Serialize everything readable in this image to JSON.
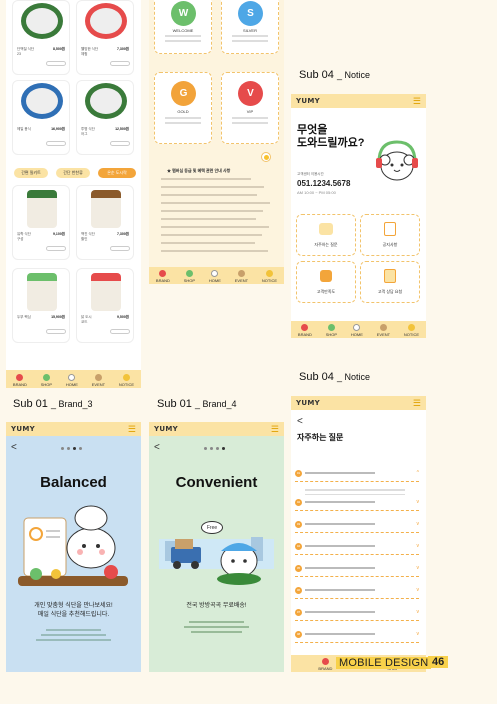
{
  "labels": {
    "sub04_notice_a": "Sub 04",
    "sub04_notice_a_suffix": "_ Notice",
    "sub04_notice_b": "Sub 04",
    "sub04_notice_b_suffix": "_ Notice",
    "sub01_brand3": "Sub 01",
    "sub01_brand3_suffix": "_ Brand_3",
    "sub01_brand4": "Sub 01",
    "sub01_brand4_suffix": "_ Brand_4"
  },
  "brand": {
    "logo": "YUMY"
  },
  "tabbar": [
    "BRAND",
    "SHOP",
    "HOME",
    "EVENT",
    "NOTICE"
  ],
  "shop": {
    "products": [
      {
        "name": "단백질 식단\n23",
        "price": "8,500원"
      },
      {
        "name": "웰빙한 식단\n체험",
        "price": "7,300원"
      },
      {
        "name": "헤일 용식",
        "price": "16,900원"
      },
      {
        "name": "투명 식단\n어그",
        "price": "12,500원"
      },
      {
        "name": "유학 식단\n구성",
        "price": "9,100원"
      },
      {
        "name": "백진 식단\n할인",
        "price": "7,300원"
      },
      {
        "name": "두부 핵심",
        "price": "15,900원"
      },
      {
        "name": "닭 도시\n코드",
        "price": "9,500원"
      }
    ],
    "filters": [
      "간편 밀키트",
      "간단 반찬류",
      "온순 도시락"
    ],
    "btn": "장바구니"
  },
  "membership": {
    "tiers": [
      {
        "letter": "W",
        "name": "WELCOME",
        "color": "#6cbf6b"
      },
      {
        "letter": "S",
        "name": "SILVER",
        "color": "#4ea7e6"
      },
      {
        "letter": "G",
        "name": "GOLD",
        "color": "#f2a33a"
      },
      {
        "letter": "V",
        "name": "VIP",
        "color": "#e64b4b"
      }
    ],
    "notice_title": "★ 멤버십 등급 및 혜택 관련 안내 사항"
  },
  "notice_help": {
    "title": "무엇을\n도와드릴까요?",
    "center_label": "고객센터 이용시간",
    "phone": "051.1234.5678",
    "hours": "AM 10:00 ~ PM 05:00",
    "items": [
      "자주하는 질문",
      "공지사항",
      "고객만족도",
      "고객 상담 요청"
    ]
  },
  "faq": {
    "back": "<",
    "title": "자주하는 질문",
    "rows": [
      "01",
      "02",
      "03",
      "04",
      "05",
      "06",
      "07",
      "08"
    ]
  },
  "brand3": {
    "headline": "Balanced",
    "copy1": "개인 맞춤형 식단을 만나보세요!",
    "copy2": "매일 식단을 추천해드립니다."
  },
  "brand4": {
    "headline": "Convenient",
    "bubble": "Free",
    "copy1": "전국 방방곡곡 무료배송!"
  },
  "footer": {
    "title": "MOBILE DESIGN",
    "page": "46"
  }
}
